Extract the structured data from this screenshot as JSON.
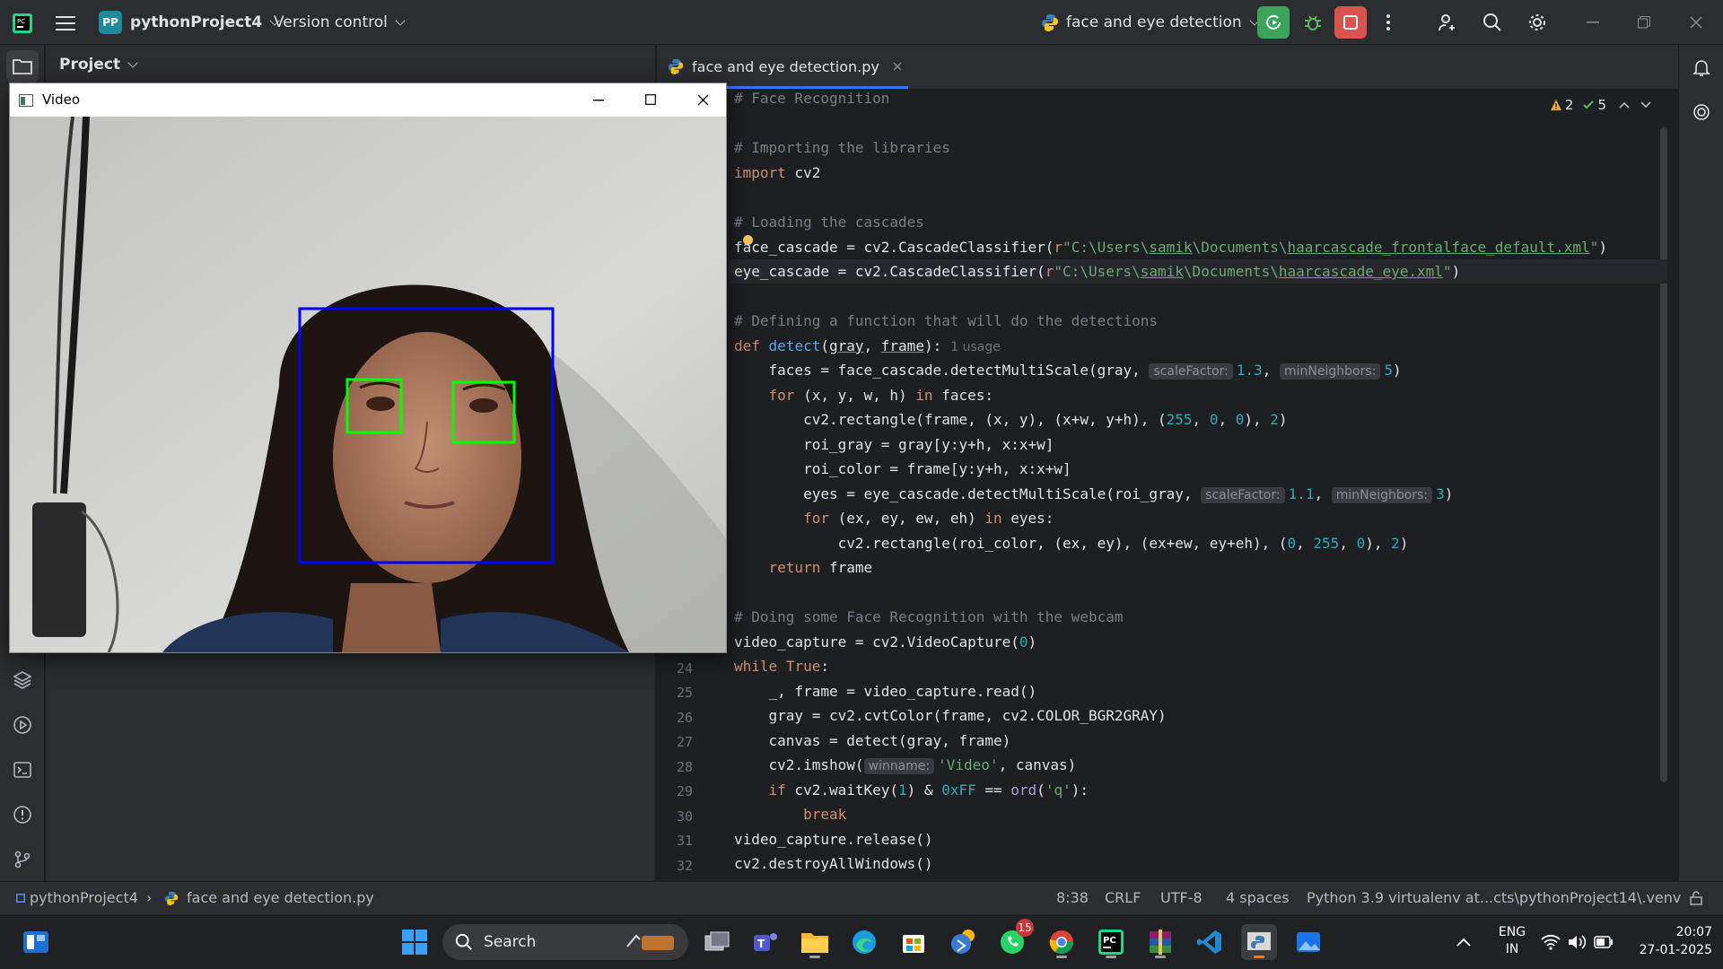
{
  "titlebar": {
    "project_badge": "PP",
    "project_name": "pythonProject4",
    "vcs_label": "Version control",
    "run_config": "face and eye detection"
  },
  "project_panel": {
    "title": "Project"
  },
  "editor": {
    "tab_label": "face and eye detection.py",
    "warnings_count": "2",
    "ok_count": "5",
    "visible_line_numbers": [
      "24",
      "25",
      "26",
      "27",
      "28",
      "29",
      "30",
      "31",
      "32"
    ],
    "usage_hint": "1 usage",
    "hints": {
      "scale_factor": "scaleFactor:",
      "min_neighbors": "minNeighbors:",
      "winname": "winname:"
    }
  },
  "video_window": {
    "title": "Video",
    "face_box_color": "#0000ff",
    "eye_box_color": "#00ff00"
  },
  "statusbar": {
    "breadcrumb_project": "pythonProject4",
    "breadcrumb_file": "face and eye detection.py",
    "position": "8:38",
    "line_sep": "CRLF",
    "encoding": "UTF-8",
    "indent": "4 spaces",
    "interpreter": "Python 3.9 virtualenv at...cts\\pythonProject14\\.venv"
  },
  "taskbar": {
    "search_label": "Search",
    "whatsapp_badge": "15",
    "lang_line1": "ENG",
    "lang_line2": "IN",
    "time": "20:07",
    "date": "27-01-2025"
  },
  "colors": {
    "accent_run": "#3ba35a",
    "accent_stop": "#d9534f",
    "editor_bg": "#1e1f22",
    "panel_bg": "#2b2d30"
  }
}
